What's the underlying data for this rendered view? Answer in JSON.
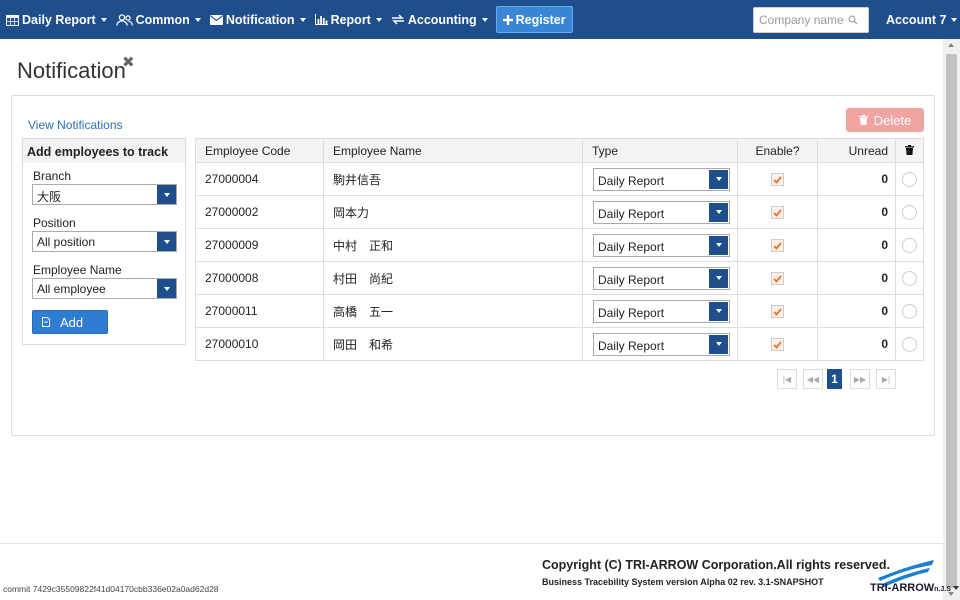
{
  "nav": {
    "items": [
      {
        "label": "Daily Report",
        "icon": "calendar-icon"
      },
      {
        "label": "Common",
        "icon": "users-icon"
      },
      {
        "label": "Notification",
        "icon": "envelope-icon"
      },
      {
        "label": "Report",
        "icon": "bar-chart-icon"
      },
      {
        "label": "Accounting",
        "icon": "exchange-icon"
      }
    ],
    "register_label": "Register",
    "company_placeholder": "Company name",
    "account_label": "Account 7"
  },
  "header": {
    "title": "Notification"
  },
  "panel": {
    "view_link": "View Notifications",
    "delete_label": "Delete"
  },
  "side_form": {
    "heading": "Add employees to track",
    "branch_label": "Branch",
    "branch_value": "大阪",
    "position_label": "Position",
    "position_value": "All position",
    "employee_label": "Employee Name",
    "employee_value": "All employee",
    "add_label": "Add"
  },
  "table": {
    "headers": {
      "code": "Employee Code",
      "name": "Employee Name",
      "type": "Type",
      "enable": "Enable?",
      "unread": "Unread"
    },
    "rows": [
      {
        "code": "27000004",
        "name": "駒井信吾",
        "type": "Daily Report",
        "enabled": true,
        "unread": "0"
      },
      {
        "code": "27000002",
        "name": "岡本力",
        "type": "Daily Report",
        "enabled": true,
        "unread": "0"
      },
      {
        "code": "27000009",
        "name": "中村　正和",
        "type": "Daily Report",
        "enabled": true,
        "unread": "0"
      },
      {
        "code": "27000008",
        "name": "村田　尚紀",
        "type": "Daily Report",
        "enabled": true,
        "unread": "0"
      },
      {
        "code": "27000011",
        "name": "高橋　五一",
        "type": "Daily Report",
        "enabled": true,
        "unread": "0"
      },
      {
        "code": "27000010",
        "name": "岡田　和希",
        "type": "Daily Report",
        "enabled": true,
        "unread": "0"
      }
    ]
  },
  "pagination": {
    "current_page": "1"
  },
  "footer": {
    "copyright": "Copyright (C) TRI-ARROW Corporation.All rights reserved.",
    "version": "Business Tracebility System version Alpha 02 rev. 3.1-SNAPSHOT",
    "commit": "commit 7429c35509822f41d04170cbb336e02a0ad62d28",
    "logo_text": "TRI-ARROW",
    "logo_suffix": "n.J.S"
  },
  "colors": {
    "navbar": "#1f4e8c",
    "register": "#3a86d6",
    "delete_disabled": "#f2a4a3",
    "check": "#e8742a",
    "link": "#2a6fb5"
  }
}
